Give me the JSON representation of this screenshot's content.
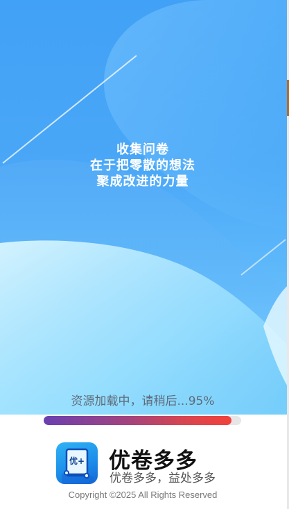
{
  "splash": {
    "slogan_lines": [
      "收集问卷",
      "在于把零散的想法",
      "聚成改进的力量"
    ]
  },
  "loading": {
    "text": "资源加载中，请稍后...95%",
    "progress": 0.95
  },
  "brand": {
    "logo_icon": "survey-logo-icon",
    "logo_glyph": "优+",
    "name": "优卷多多",
    "tagline": "优卷多多，益处多多"
  },
  "footer": {
    "copyright": "Copyright ©2025 All Rights Reserved"
  },
  "colors": {
    "hero_blue": "#41a1f6",
    "hero_cyan": "#8fdcff",
    "progress_start": "#6b3fb0",
    "progress_end": "#f2413b",
    "logo_blue": "#1d8fea"
  }
}
